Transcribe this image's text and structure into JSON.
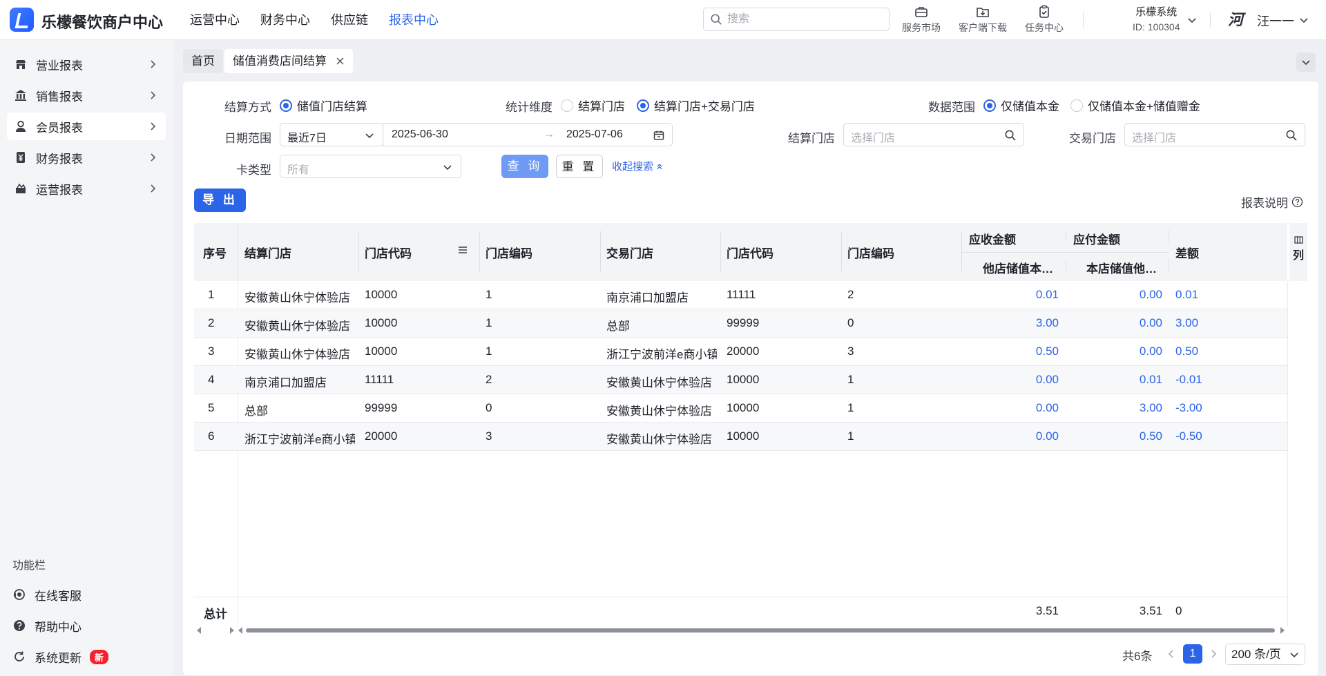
{
  "app": {
    "name": "乐檬餐饮商户中心"
  },
  "topnav": {
    "items": [
      "运营中心",
      "财务中心",
      "供应链",
      "报表中心"
    ],
    "active": "报表中心"
  },
  "search": {
    "placeholder": "搜索"
  },
  "tools": {
    "service_market": "服务市场",
    "client_download": "客户端下载",
    "task_center": "任务中心"
  },
  "system": {
    "name": "乐檬系统",
    "id": "ID: 100304"
  },
  "user": {
    "avatar_text": "河",
    "name": "汪一一"
  },
  "sidebar": {
    "items": [
      {
        "label": "营业报表",
        "icon": "store-icon"
      },
      {
        "label": "销售报表",
        "icon": "bank-icon"
      },
      {
        "label": "会员报表",
        "icon": "user-icon"
      },
      {
        "label": "财务报表",
        "icon": "finance-icon"
      },
      {
        "label": "运营报表",
        "icon": "operation-icon"
      }
    ],
    "active": "会员报表",
    "func_title": "功能栏",
    "func_items": [
      {
        "label": "在线客服",
        "icon": "headset-icon"
      },
      {
        "label": "帮助中心",
        "icon": "help-icon"
      },
      {
        "label": "系统更新",
        "icon": "refresh-icon",
        "badge": "新"
      }
    ]
  },
  "tabs": {
    "home": "首页",
    "current": "储值消费店间结算"
  },
  "filters": {
    "settle_method_label": "结算方式",
    "settle_method_option": "储值门店结算",
    "dimension_label": "统计维度",
    "dimension_options": [
      "结算门店",
      "结算门店+交易门店"
    ],
    "dimension_selected": "结算门店+交易门店",
    "data_range_label": "数据范围",
    "data_range_options": [
      "仅储值本金",
      "仅储值本金+储值赠金"
    ],
    "data_range_selected": "仅储值本金",
    "date_label": "日期范围",
    "date_preset": "最近7日",
    "date_start": "2025-06-30",
    "date_arrow": "→",
    "date_end": "2025-07-06",
    "settle_store_label": "结算门店",
    "settle_store_placeholder": "选择门店",
    "trade_store_label": "交易门店",
    "trade_store_placeholder": "选择门店",
    "card_type_label": "卡类型",
    "card_type_value": "所有",
    "query_label": "查 询",
    "reset_label": "重 置",
    "collapse_label": "收起搜索"
  },
  "actions": {
    "export_label": "导 出",
    "report_desc": "报表说明"
  },
  "table": {
    "headers": {
      "seq": "序号",
      "settle_store": "结算门店",
      "store_code": "门店代码",
      "store_no": "门店编码",
      "trade_store": "交易门店",
      "trade_code": "门店代码",
      "trade_no": "门店编码",
      "receivable": "应收金额",
      "receivable_sub": "他店储值本…",
      "payable": "应付金额",
      "payable_sub": "本店储值他…",
      "diff": "差额",
      "col_setting": "列"
    },
    "rows": [
      {
        "seq": "1",
        "settle_store": "安徽黄山休宁体验店",
        "store_code": "10000",
        "store_no": "1",
        "trade_store": "南京浦口加盟店",
        "trade_code": "11111",
        "trade_no": "2",
        "receivable": "0.01",
        "payable": "0.00",
        "diff": "0.01"
      },
      {
        "seq": "2",
        "settle_store": "安徽黄山休宁体验店",
        "store_code": "10000",
        "store_no": "1",
        "trade_store": "总部",
        "trade_code": "99999",
        "trade_no": "0",
        "receivable": "3.00",
        "payable": "0.00",
        "diff": "3.00"
      },
      {
        "seq": "3",
        "settle_store": "安徽黄山休宁体验店",
        "store_code": "10000",
        "store_no": "1",
        "trade_store": "浙江宁波前洋e商小镇",
        "trade_code": "20000",
        "trade_no": "3",
        "receivable": "0.50",
        "payable": "0.00",
        "diff": "0.50"
      },
      {
        "seq": "4",
        "settle_store": "南京浦口加盟店",
        "store_code": "11111",
        "store_no": "2",
        "trade_store": "安徽黄山休宁体验店",
        "trade_code": "10000",
        "trade_no": "1",
        "receivable": "0.00",
        "payable": "0.01",
        "diff": "-0.01"
      },
      {
        "seq": "5",
        "settle_store": "总部",
        "store_code": "99999",
        "store_no": "0",
        "trade_store": "安徽黄山休宁体验店",
        "trade_code": "10000",
        "trade_no": "1",
        "receivable": "0.00",
        "payable": "3.00",
        "diff": "-3.00"
      },
      {
        "seq": "6",
        "settle_store": "浙江宁波前洋e商小镇",
        "store_code": "20000",
        "store_no": "3",
        "trade_store": "安徽黄山休宁体验店",
        "trade_code": "10000",
        "trade_no": "1",
        "receivable": "0.00",
        "payable": "0.50",
        "diff": "-0.50"
      }
    ],
    "total": {
      "label": "总计",
      "receivable": "3.51",
      "payable": "3.51",
      "diff": "0"
    }
  },
  "pagination": {
    "total": "共6条",
    "current": "1",
    "page_size": "200 条/页"
  },
  "colors": {
    "accent": "#2c64e8",
    "badge": "#f5222d"
  }
}
